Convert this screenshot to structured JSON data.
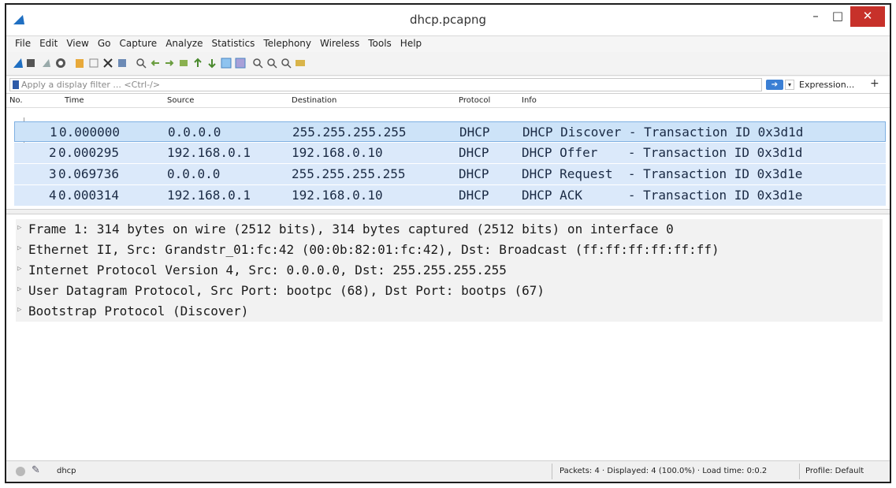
{
  "window": {
    "title": "dhcp.pcapng",
    "minimize": "–",
    "maximize": "□",
    "close": "✕"
  },
  "menu": [
    "File",
    "Edit",
    "View",
    "Go",
    "Capture",
    "Analyze",
    "Statistics",
    "Telephony",
    "Wireless",
    "Tools",
    "Help"
  ],
  "filter": {
    "placeholder": "Apply a display filter ... <Ctrl-/>",
    "apply_icon": "arrow-right-icon",
    "expression_label": "Expression...",
    "add_label": "+"
  },
  "packet_list": {
    "columns": [
      "No.",
      "Time",
      "Source",
      "Destination",
      "Protocol",
      "Info"
    ],
    "rows": [
      {
        "no": "1",
        "time": "0.000000",
        "source": "0.0.0.0",
        "destination": "255.255.255.255",
        "protocol": "DHCP",
        "info": "DHCP Discover - Transaction ID 0x3d1d"
      },
      {
        "no": "2",
        "time": "0.000295",
        "source": "192.168.0.1",
        "destination": "192.168.0.10",
        "protocol": "DHCP",
        "info": "DHCP Offer    - Transaction ID 0x3d1d"
      },
      {
        "no": "3",
        "time": "0.069736",
        "source": "0.0.0.0",
        "destination": "255.255.255.255",
        "protocol": "DHCP",
        "info": "DHCP Request  - Transaction ID 0x3d1e"
      },
      {
        "no": "4",
        "time": "0.000314",
        "source": "192.168.0.1",
        "destination": "192.168.0.10",
        "protocol": "DHCP",
        "info": "DHCP ACK      - Transaction ID 0x3d1e"
      }
    ]
  },
  "details": [
    "Frame 1: 314 bytes on wire (2512 bits), 314 bytes captured (2512 bits) on interface 0",
    "Ethernet II, Src: Grandstr_01:fc:42 (00:0b:82:01:fc:42), Dst: Broadcast (ff:ff:ff:ff:ff:ff)",
    "Internet Protocol Version 4, Src: 0.0.0.0, Dst: 255.255.255.255",
    "User Datagram Protocol, Src Port: bootpc (68), Dst Port: bootps (67)",
    "Bootstrap Protocol (Discover)"
  ],
  "status": {
    "profile_text": "dhcp",
    "packets_text": "Packets: 4 · Displayed: 4 (100.0%) · Load time: 0:0.2",
    "profile_label": "Profile: Default"
  },
  "colors": {
    "row_bg": "#dbe9fa",
    "close_btn": "#c7312a",
    "accent": "#3b7fd4"
  }
}
